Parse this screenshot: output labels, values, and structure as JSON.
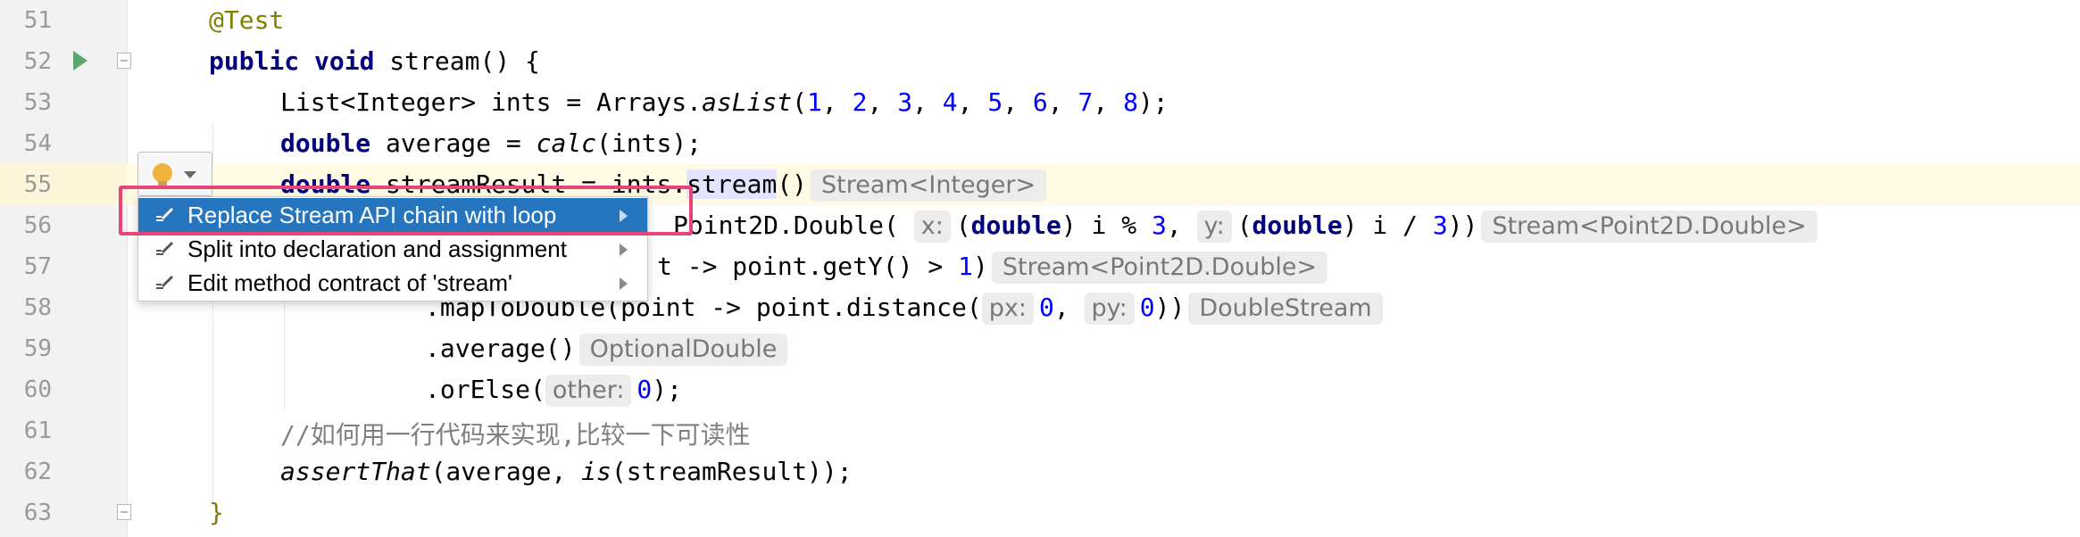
{
  "editor": {
    "lines": [
      {
        "num": "51"
      },
      {
        "num": "52"
      },
      {
        "num": "53"
      },
      {
        "num": "54"
      },
      {
        "num": "55"
      },
      {
        "num": "56"
      },
      {
        "num": "57"
      },
      {
        "num": "58"
      },
      {
        "num": "59"
      },
      {
        "num": "60"
      },
      {
        "num": "61"
      },
      {
        "num": "62"
      },
      {
        "num": "63"
      }
    ],
    "code": {
      "l51_ann": "@Test",
      "l52_kw1": "public",
      "l52_kw2": "void",
      "l52_rest": " stream() {",
      "l53_a": "List<Integer> ints = Arrays.",
      "l53_static": "asList",
      "l53_b": "(",
      "l53_nums": [
        "1",
        "2",
        "3",
        "4",
        "5",
        "6",
        "7",
        "8"
      ],
      "l53_end": ");",
      "l54_kw": "double",
      "l54_a": " average = ",
      "l54_static": "calc",
      "l54_b": "(ints);",
      "l55_kw": "double",
      "l55_a": " streamResult = ints.",
      "l55_hl": "stream",
      "l55_b": "()",
      "l55_hint": "Stream<Integer>",
      "l56_a": "Point2D.Double(",
      "l56_hint_x": "x:",
      "l56_b": "(",
      "l56_kw1": "double",
      "l56_c": ") i % ",
      "l56_n1": "3",
      "l56_d": ", ",
      "l56_hint_y": "y:",
      "l56_e": "(",
      "l56_kw2": "double",
      "l56_f": ") i / ",
      "l56_n2": "3",
      "l56_g": "))",
      "l56_hint": "Stream<Point2D.Double>",
      "l57_a": "t -> point.getY() > ",
      "l57_n": "1",
      "l57_b": ")",
      "l57_hint": "Stream<Point2D.Double>",
      "l58_a": ".mapToDouble(point -> point.distance(",
      "l58_hint_px": "px:",
      "l58_n1": "0",
      "l58_b": ", ",
      "l58_hint_py": "py:",
      "l58_n2": "0",
      "l58_c": "))",
      "l58_hint": "DoubleStream",
      "l59_a": ".average()",
      "l59_hint": "OptionalDouble",
      "l60_a": ".orElse(",
      "l60_hint": "other:",
      "l60_n": "0",
      "l60_b": ");",
      "l61_cmt": "//如何用一行代码来实现,比较一下可读性",
      "l62_static1": "assertThat",
      "l62_a": "(average, ",
      "l62_static2": "is",
      "l62_b": "(streamResult));",
      "l63": "}"
    }
  },
  "intention_menu": {
    "items": [
      {
        "label": "Replace Stream API chain with loop",
        "selected": true
      },
      {
        "label": "Split into declaration and assignment",
        "selected": false
      },
      {
        "label": "Edit method contract of 'stream'",
        "selected": false
      }
    ]
  },
  "colors": {
    "keyword": "#000080",
    "number": "#0000ff",
    "annotation": "#808000",
    "selection": "#2675bf",
    "current_line": "#fffae3",
    "callout": "#e6457a"
  }
}
